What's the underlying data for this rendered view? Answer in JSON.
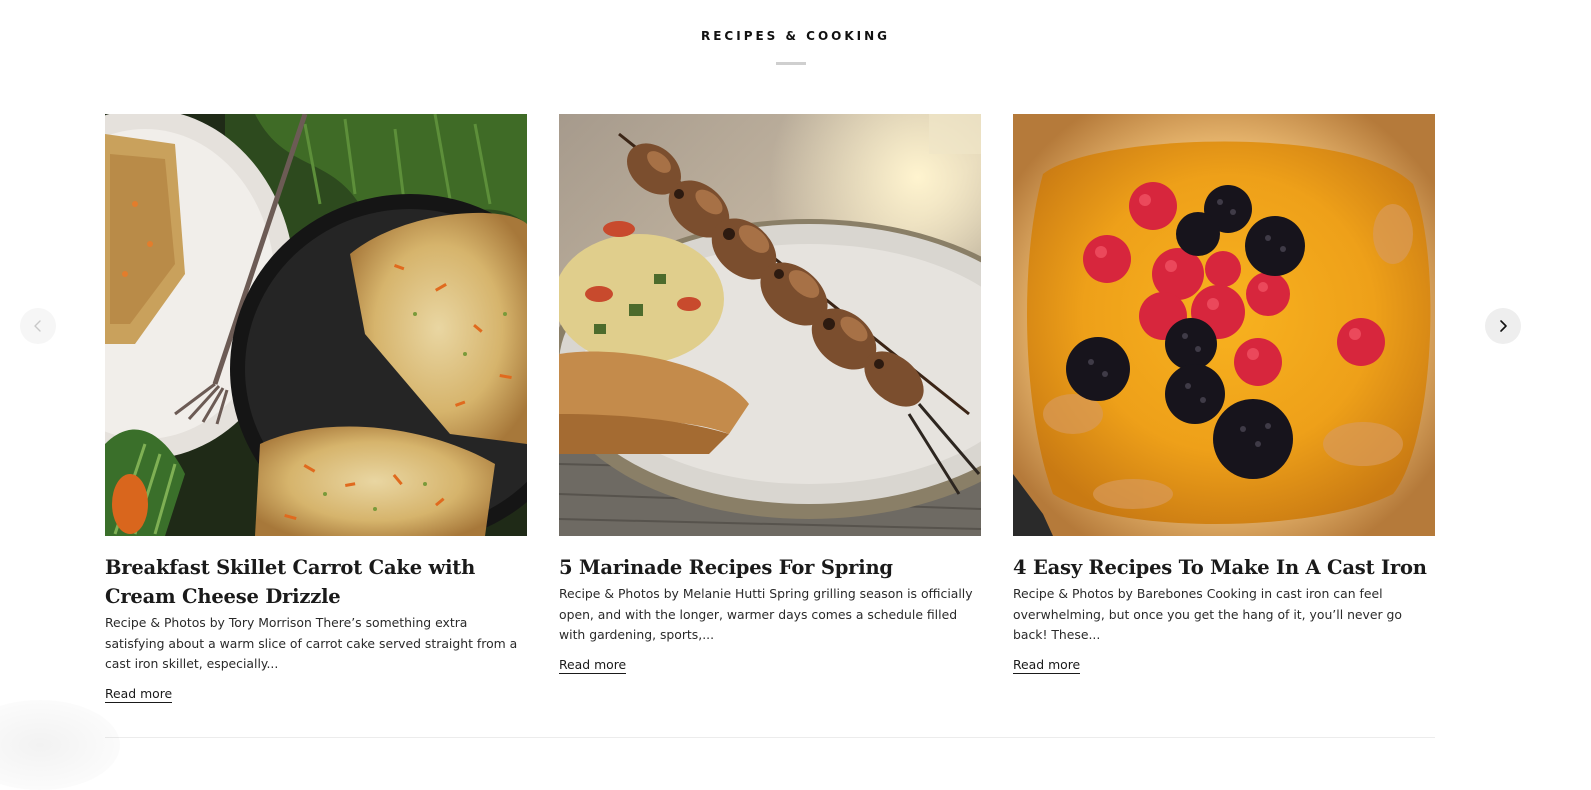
{
  "section": {
    "title": "RECIPES & COOKING"
  },
  "carousel": {
    "prev_icon": "chevron-left-icon",
    "next_icon": "chevron-right-icon"
  },
  "cards": [
    {
      "title": "Breakfast Skillet Carrot Cake with Cream Cheese Drizzle",
      "excerpt": "Recipe & Photos by Tory Morrison There’s something extra satisfying about a warm slice of carrot cake served straight from a cast iron skillet, especially...",
      "read_more": "Read more",
      "image": "carrot-cake-skillet-photo"
    },
    {
      "title": "5 Marinade Recipes For Spring",
      "excerpt": "Recipe & Photos by Melanie Hutti Spring grilling season is officially open, and with the longer, warmer days comes a schedule filled with gardening, sports,...",
      "read_more": "Read more",
      "image": "grilled-skewer-couscous-photo"
    },
    {
      "title": "4 Easy Recipes To Make In A Cast Iron",
      "excerpt": "Recipe & Photos by Barebones Cooking in cast iron can feel overwhelming, but once you get the hang of it, you’ll never go back! These...",
      "read_more": "Read more",
      "image": "dutch-baby-berries-photo"
    }
  ]
}
